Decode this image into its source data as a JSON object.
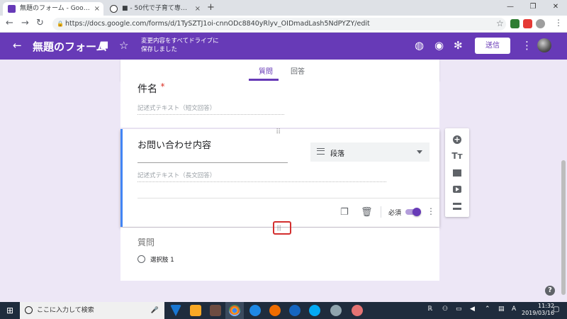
{
  "browser": {
    "tabs": [
      {
        "title": "無題のフォーム - Google フォーム",
        "close": "×"
      },
      {
        "title": "■ - 50代で子育て専業主夫になっ",
        "close": "×"
      }
    ],
    "new_tab": "+",
    "window_controls": {
      "minimize": "—",
      "maximize": "❐",
      "close": "✕"
    },
    "nav": {
      "back": "←",
      "forward": "→",
      "reload": "↻"
    },
    "url": "https://docs.google.com/forms/d/1TySZTJ1oi-cnnODc8840yRlyv_OIDmadLash5NdPYZY/edit",
    "star": "☆",
    "menu": "⋮"
  },
  "forms_header": {
    "back": "←",
    "title": "無題のフォーム",
    "save_status": "変更内容をすべてドライブに保存しました",
    "send_label": "送信",
    "more": "⋮"
  },
  "form_tabs": {
    "questions": "質問",
    "responses": "回答"
  },
  "question1": {
    "title": "件名",
    "required_mark": "*",
    "placeholder": "記述式テキスト（短文回答）"
  },
  "question2": {
    "title": "お問い合わせ内容",
    "type_label": "段落",
    "placeholder": "記述式テキスト（長文回答）",
    "required_label": "必須",
    "required_on": true,
    "drag_handle": "⠿"
  },
  "question3": {
    "title": "質問",
    "option_label": "選択肢 1"
  },
  "toolbar": {
    "add": "+",
    "title_text": "Tт"
  },
  "help": "?",
  "taskbar": {
    "search_placeholder": "ここに入力して検索",
    "time": "11:32",
    "date": "2019/03/16"
  },
  "colors": {
    "brand": "#673ab7",
    "background": "#ede7f6",
    "accent_bar": "#4285f4",
    "highlight": "#d32f2f"
  }
}
